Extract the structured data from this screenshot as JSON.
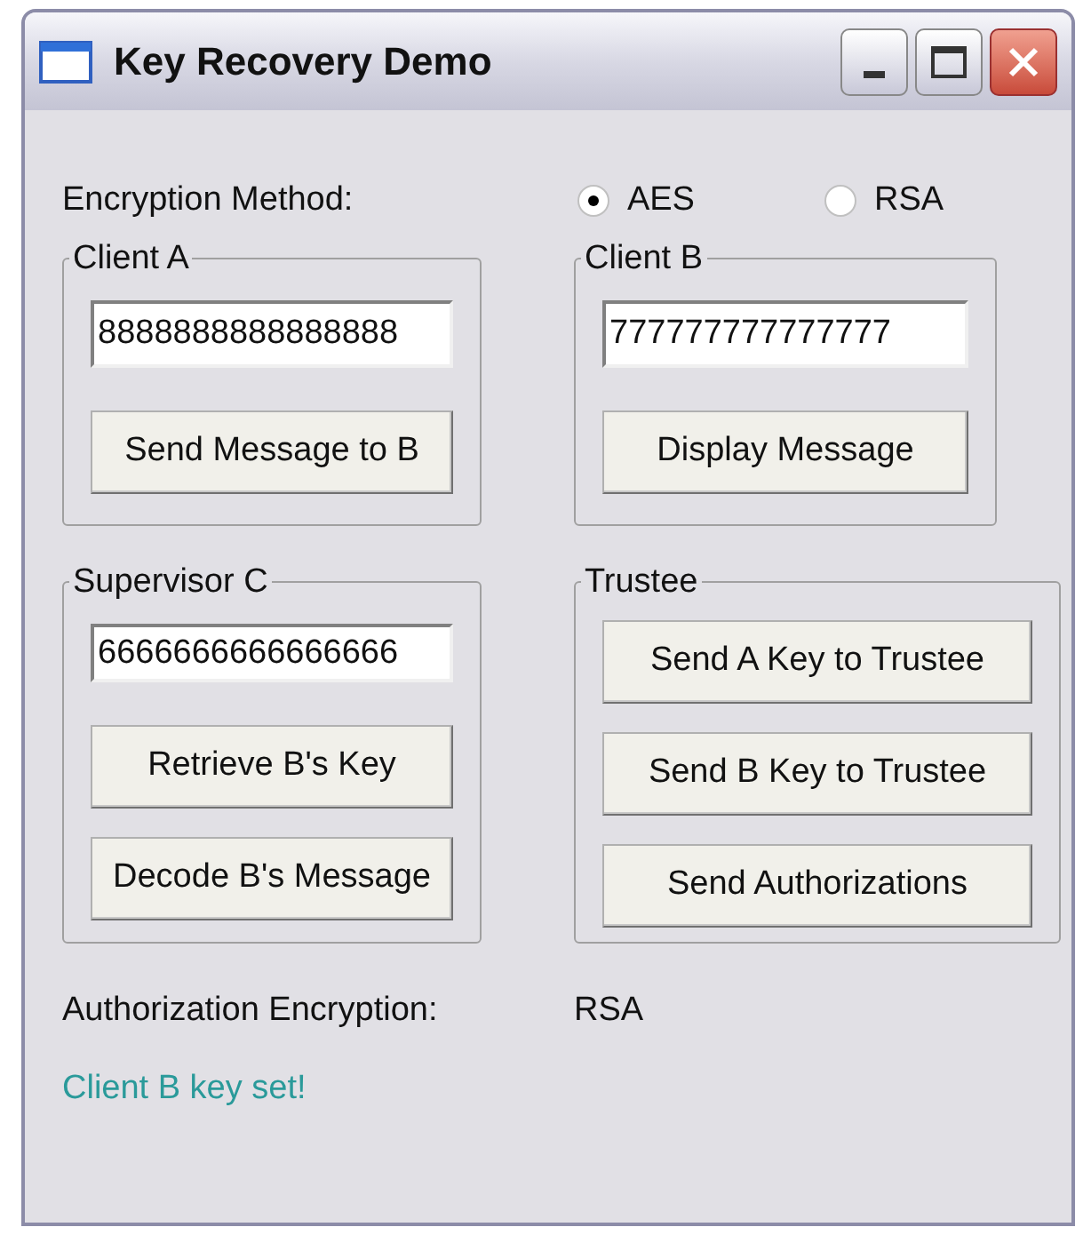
{
  "window": {
    "title": "Key Recovery Demo"
  },
  "encryption_method": {
    "label": "Encryption Method:",
    "options": [
      {
        "label": "AES",
        "selected": true
      },
      {
        "label": "RSA",
        "selected": false
      }
    ]
  },
  "groups": [
    {
      "title": "Client A",
      "field": {
        "value": "8888888888888888"
      },
      "buttons": [
        "Send Message to B"
      ]
    },
    {
      "title": "Client B",
      "field": {
        "value": "777777777777777"
      },
      "buttons": [
        "Display Message"
      ]
    },
    {
      "title": "Supervisor C",
      "field": {
        "value": "6666666666666666"
      },
      "buttons": [
        "Retrieve B's Key",
        "Decode B's Message"
      ]
    },
    {
      "title": "Trustee",
      "buttons": [
        "Send A Key to Trustee",
        "Send B Key to Trustee",
        "Send Authorizations"
      ]
    }
  ],
  "authorization": {
    "label": "Authorization Encryption:",
    "value": "RSA"
  },
  "status": "Client B key set!"
}
